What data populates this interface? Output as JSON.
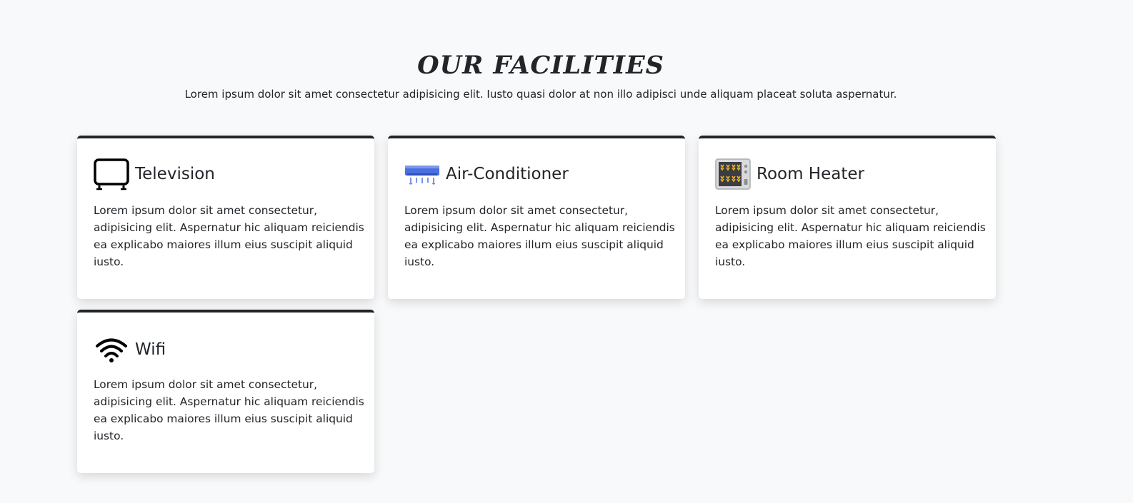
{
  "section": {
    "title": "OUR FACILITIES",
    "subtitle": "Lorem ipsum dolor sit amet consectetur adipisicing elit. Iusto quasi dolor at non illo adipisci unde aliquam placeat soluta aspernatur."
  },
  "facilities": [
    {
      "icon": "television-icon",
      "name": "Television",
      "description": "Lorem ipsum dolor sit amet consectetur, adipisicing elit. Aspernatur hic aliquam reiciendis ea explicabo maiores illum eius suscipit aliquid iusto."
    },
    {
      "icon": "air-conditioner-icon",
      "name": "Air-Conditioner",
      "description": "Lorem ipsum dolor sit amet consectetur, adipisicing elit. Aspernatur hic aliquam reiciendis ea explicabo maiores illum eius suscipit aliquid iusto."
    },
    {
      "icon": "room-heater-icon",
      "name": "Room Heater",
      "description": "Lorem ipsum dolor sit amet consectetur, adipisicing elit. Aspernatur hic aliquam reiciendis ea explicabo maiores illum eius suscipit aliquid iusto."
    },
    {
      "icon": "wifi-icon",
      "name": "Wifi",
      "description": "Lorem ipsum dolor sit amet consectetur, adipisicing elit. Aspernatur hic aliquam reiciendis ea explicabo maiores illum eius suscipit aliquid iusto."
    }
  ],
  "colors": {
    "page_background": "#f8f9fa",
    "card_background": "#ffffff",
    "card_top_border": "#212529",
    "text": "#212529",
    "ac_blue": "#4a6fe0",
    "heater_amber": "#f0b323"
  }
}
